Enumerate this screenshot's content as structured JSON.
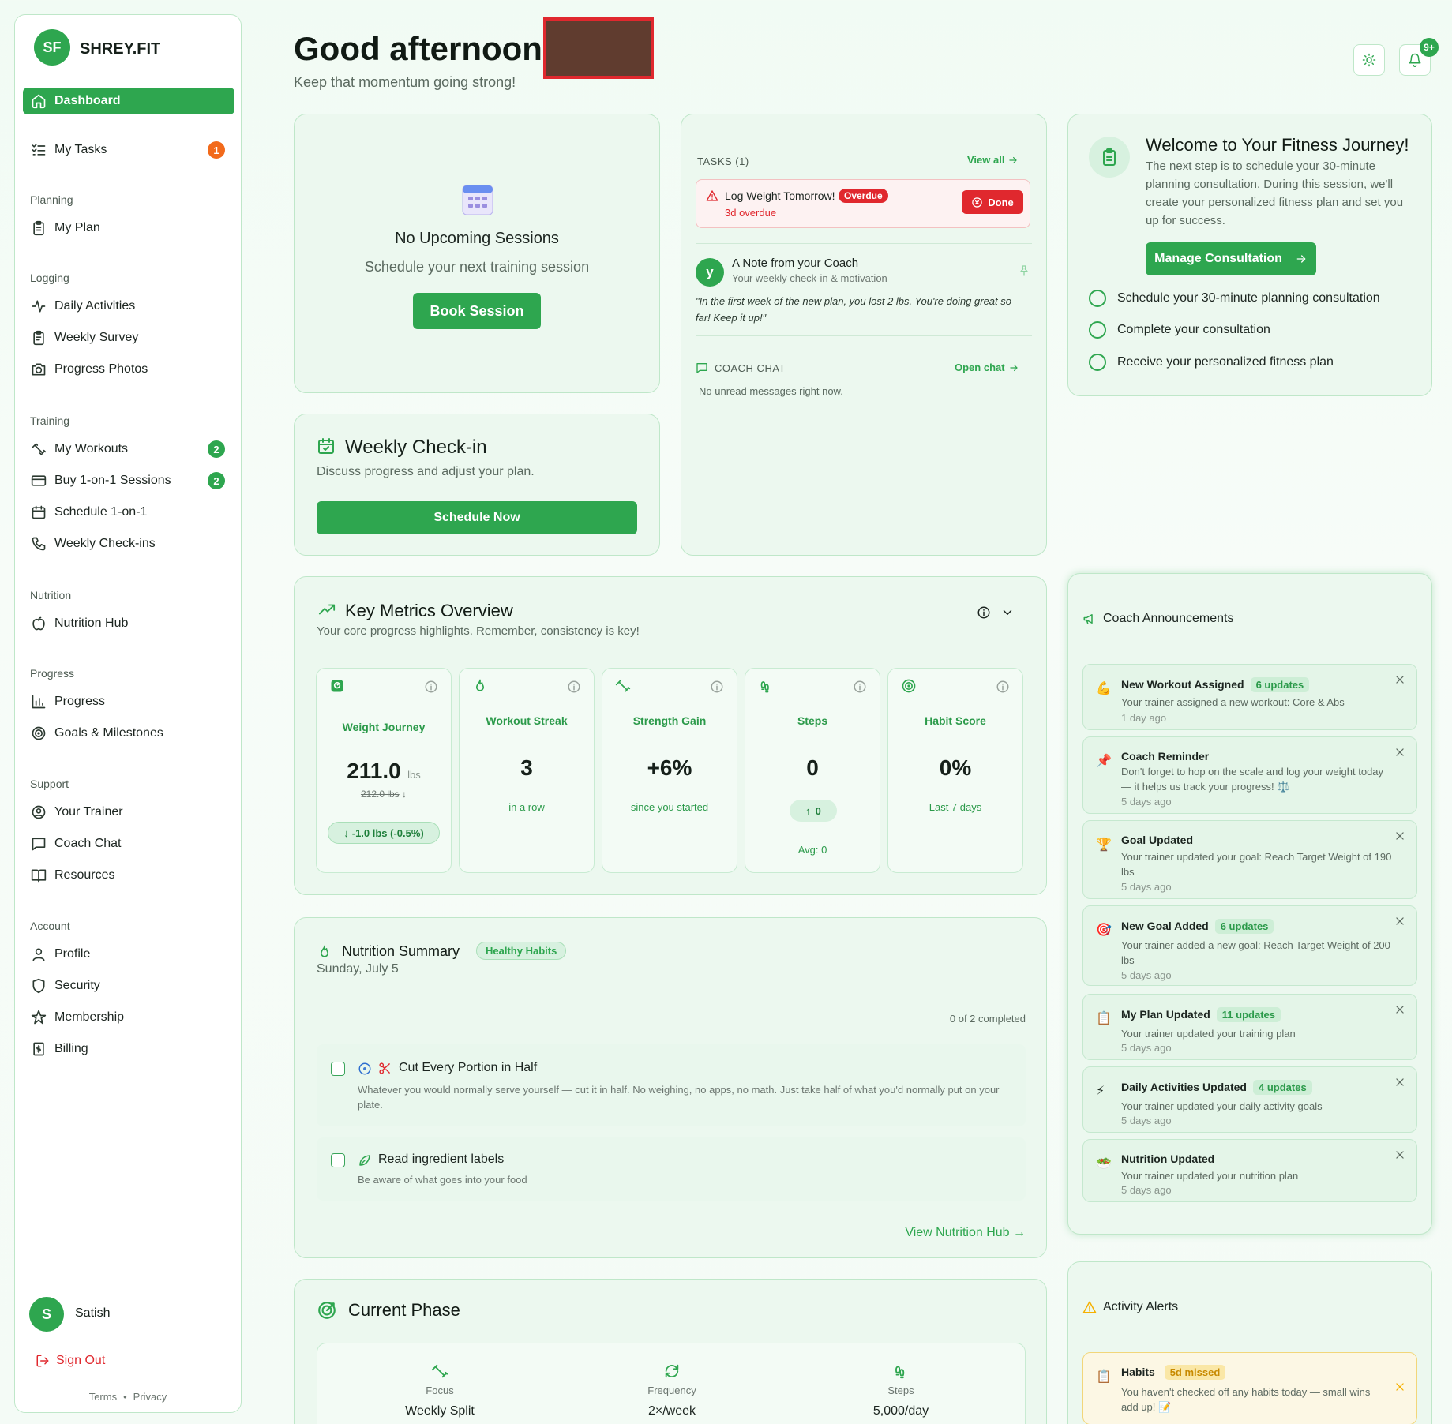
{
  "brand": {
    "initials": "SF",
    "name": "SHREY.FIT"
  },
  "sidebar": {
    "dashboard": "Dashboard",
    "my_tasks": "My Tasks",
    "my_tasks_badge": "1",
    "sections": {
      "planning": "Planning",
      "logging": "Logging",
      "training": "Training",
      "nutrition": "Nutrition",
      "progress": "Progress",
      "support": "Support",
      "account": "Account"
    },
    "items": {
      "my_plan": "My Plan",
      "daily_activities": "Daily Activities",
      "weekly_survey": "Weekly Survey",
      "progress_photos": "Progress Photos",
      "my_workouts": "My Workouts",
      "my_workouts_badge": "2",
      "buy_sessions": "Buy 1-on-1 Sessions",
      "buy_sessions_badge": "2",
      "schedule_1on1": "Schedule 1-on-1",
      "weekly_checkins": "Weekly Check-ins",
      "nutrition_hub": "Nutrition Hub",
      "progress": "Progress",
      "goals": "Goals & Milestones",
      "your_trainer": "Your Trainer",
      "coach_chat": "Coach Chat",
      "resources": "Resources",
      "profile": "Profile",
      "security": "Security",
      "membership": "Membership",
      "billing": "Billing"
    },
    "user": {
      "initial": "S",
      "name": "Satish"
    },
    "sign_out": "Sign Out",
    "terms": "Terms",
    "dot": "•",
    "privacy": "Privacy"
  },
  "header": {
    "greeting": "Good afternoon,",
    "subtitle": "Keep that momentum going strong!",
    "notif_badge": "9+"
  },
  "sessions": {
    "title": "No Upcoming Sessions",
    "subtitle": "Schedule your next training session",
    "button": "Book Session"
  },
  "checkin": {
    "title": "Weekly Check-in",
    "subtitle": "Discuss progress and adjust your plan.",
    "button": "Schedule Now"
  },
  "tasks": {
    "header": "TASKS (1)",
    "view_all": "View all",
    "task_title": "Log Weight Tomorrow!",
    "task_badge": "Overdue",
    "task_sub": "3d overdue",
    "done": "Done",
    "note_avatar": "y",
    "note_title": "A Note from your Coach",
    "note_sub": "Your weekly check-in & motivation",
    "note_quote": "\"In the first week of the new plan, you lost 2 lbs. You're doing great so far! Keep it up!\"",
    "chat_header": "COACH CHAT",
    "open_chat": "Open chat",
    "chat_empty": "No unread messages right now."
  },
  "welcome": {
    "title": "Welcome to Your Fitness Journey!",
    "text": "The next step is to schedule your 30-minute planning consultation. During this session, we'll create your personalized fitness plan and set you up for success.",
    "button": "Manage Consultation",
    "steps": [
      "Schedule your 30-minute planning consultation",
      "Complete your consultation",
      "Receive your personalized fitness plan"
    ]
  },
  "metrics": {
    "title": "Key Metrics Overview",
    "subtitle": "Your core progress highlights. Remember, consistency is key!",
    "weight": {
      "label": "Weight Journey",
      "value": "211.0",
      "unit": "lbs",
      "prev": "212.0 lbs",
      "change": "-1.0 lbs (-0.5%)"
    },
    "streak": {
      "label": "Workout Streak",
      "value": "3",
      "sub": "in a row"
    },
    "strength": {
      "label": "Strength Gain",
      "value": "+6%",
      "sub": "since you started"
    },
    "steps": {
      "label": "Steps",
      "value": "0",
      "chip": "0",
      "sub": "Avg: 0"
    },
    "habit": {
      "label": "Habit Score",
      "value": "0%",
      "sub": "Last 7 days"
    }
  },
  "nutrition": {
    "title": "Nutrition Summary",
    "badge": "Healthy Habits",
    "date": "Sunday, July 5",
    "completed": "0 of 2 completed",
    "habits": [
      {
        "title": "Cut Every Portion in Half",
        "desc": "Whatever you would normally serve yourself — cut it in half. No weighing, no apps, no math. Just take half of what you'd normally put on your plate."
      },
      {
        "title": "Read ingredient labels",
        "desc": "Be aware of what goes into your food"
      }
    ],
    "link": "View Nutrition Hub →"
  },
  "phase": {
    "title": "Current Phase",
    "items": [
      {
        "label": "Focus",
        "value": "Weekly Split"
      },
      {
        "label": "Frequency",
        "value": "2×/week"
      },
      {
        "label": "Steps",
        "value": "5,000/day"
      }
    ]
  },
  "announcements": {
    "title": "Coach Announcements",
    "items": [
      {
        "emoji": "💪",
        "title": "New Workout Assigned",
        "badge": "6 updates",
        "text": "Your trainer assigned a new workout: Core & Abs",
        "time": "1 day ago"
      },
      {
        "emoji": "📌",
        "title": "Coach Reminder",
        "badge": "",
        "text": "Don't forget to hop on the scale and log your weight today — it helps us track your progress! ⚖️",
        "time": "5 days ago"
      },
      {
        "emoji": "🏆",
        "title": "Goal Updated",
        "badge": "",
        "text": "Your trainer updated your goal: Reach Target Weight of 190 lbs",
        "time": "5 days ago"
      },
      {
        "emoji": "🎯",
        "title": "New Goal Added",
        "badge": "6 updates",
        "text": "Your trainer added a new goal: Reach Target Weight of 200 lbs",
        "time": "5 days ago"
      },
      {
        "emoji": "📋",
        "title": "My Plan Updated",
        "badge": "11 updates",
        "text": "Your trainer updated your training plan",
        "time": "5 days ago"
      },
      {
        "emoji": "⚡",
        "title": "Daily Activities Updated",
        "badge": "4 updates",
        "text": "Your trainer updated your daily activity goals",
        "time": "5 days ago"
      },
      {
        "emoji": "🥗",
        "title": "Nutrition Updated",
        "badge": "",
        "text": "Your trainer updated your nutrition plan",
        "time": "5 days ago"
      }
    ]
  },
  "alerts": {
    "title": "Activity Alerts",
    "item": {
      "emoji": "📋",
      "title": "Habits",
      "badge": "5d missed",
      "text": "You haven't checked off any habits today — small wins add up! 📝"
    }
  },
  "colors": {
    "accent": "#2ea64f",
    "danger": "#e0282e",
    "orange": "#f26a1b",
    "warning": "#f5b000"
  }
}
